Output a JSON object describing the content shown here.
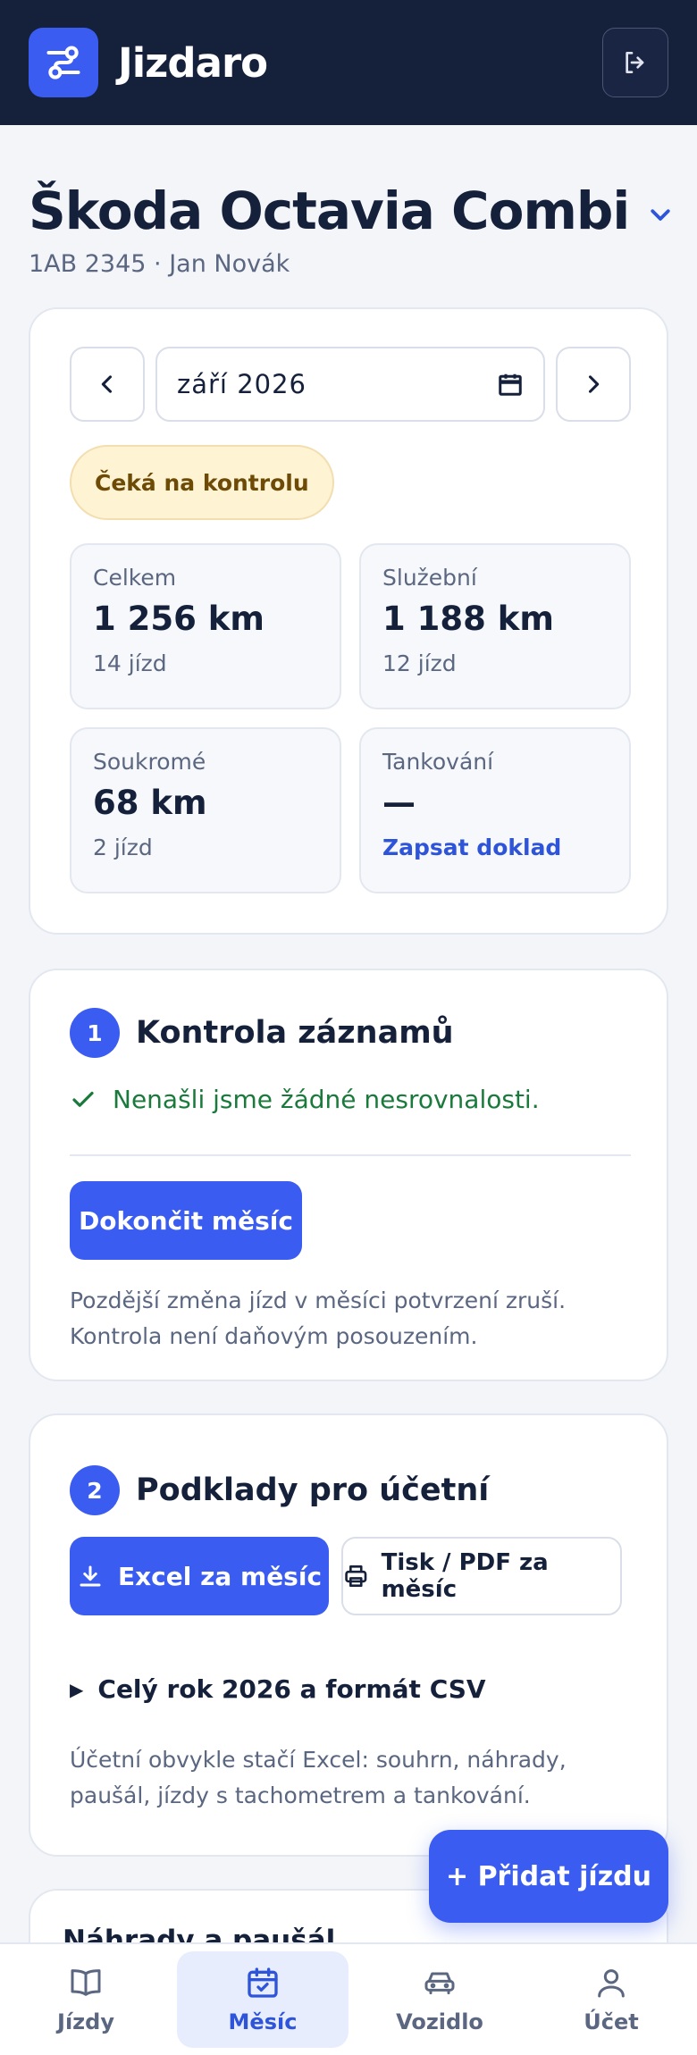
{
  "app": {
    "brand": "Jizdaro"
  },
  "vehicle": {
    "name": "Škoda Octavia Combi",
    "subtitle": "1AB 2345 · Jan Novák"
  },
  "month_picker": {
    "value": "září  2026"
  },
  "status": "Čeká na kontrolu",
  "stats": [
    {
      "label": "Celkem",
      "value": "1 256 km",
      "sub": "14 jízd"
    },
    {
      "label": "Služební",
      "value": "1 188 km",
      "sub": "12 jízd"
    },
    {
      "label": "Soukromé",
      "value": "68 km",
      "sub": "2 jízd"
    },
    {
      "label": "Tankování",
      "value": "—",
      "link": "Zapsat doklad"
    }
  ],
  "step1": {
    "number": "1",
    "title": "Kontrola záznamů",
    "ok_message": "Nenašli jsme žádné nesrovnalosti.",
    "button": "Dokončit měsíc",
    "note": "Pozdější změna jízd v měsíci potvrzení zruší. Kontrola není daňovým posouzením."
  },
  "step2": {
    "number": "2",
    "title": "Podklady pro účetní",
    "excel_button": "Excel za měsíc",
    "print_button": "Tisk / PDF za měsíc",
    "details_label": "Celý rok 2026 a formát CSV",
    "note": "Účetní obvykle stačí Excel: souhrn, náhrady, paušál, jízdy s tachometrem a tankování."
  },
  "next_section": {
    "title": "Náhrady a paušál"
  },
  "fab": {
    "label": "+ Přidat jízdu"
  },
  "bottom_nav": [
    {
      "label": "Jízdy",
      "icon": "book-icon"
    },
    {
      "label": "Měsíc",
      "icon": "calendar-check-icon"
    },
    {
      "label": "Vozidlo",
      "icon": "car-icon"
    },
    {
      "label": "Účet",
      "icon": "user-icon"
    }
  ],
  "colors": {
    "topbar": "#15203b",
    "accent": "#3a5cf0",
    "status_bg": "#fef3d3",
    "success": "#1a7a3c"
  }
}
